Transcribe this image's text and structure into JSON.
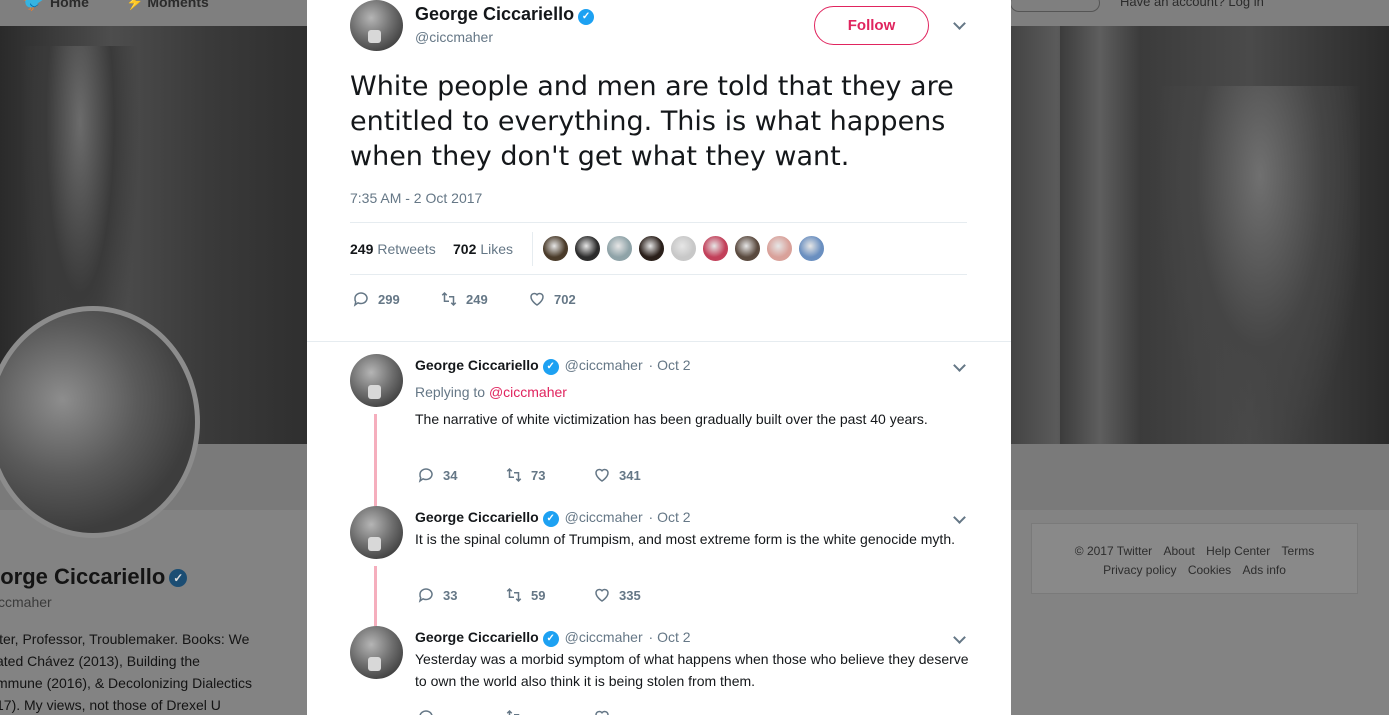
{
  "background_page": {
    "nav": {
      "home": "Home",
      "moments": "Moments",
      "account": "Have an account? Log in"
    },
    "profile": {
      "name": "eorge Ciccariello",
      "handle": "ccmaher",
      "bio_lines": [
        "iter, Professor, Troublemaker. Books: We",
        "ated Chávez (2013), Building the",
        "mmune (2016), & Decolonizing Dialectics",
        "17). My views, not those of Drexel U"
      ]
    },
    "footer": {
      "row1": [
        "© 2017 Twitter",
        "About",
        "Help Center",
        "Terms"
      ],
      "row2": [
        "Privacy policy",
        "Cookies",
        "Ads info"
      ]
    }
  },
  "main_tweet": {
    "name": "George Ciccariello",
    "handle": "@ciccmaher",
    "follow_label": "Follow",
    "text": "White people and men are told that they are entitled to everything. This is what happens when they don't get what they want.",
    "timestamp": "7:35 AM - 2 Oct 2017",
    "retweets_count": "249",
    "retweets_label": "Retweets",
    "likes_count": "702",
    "likes_label": "Likes",
    "liker_colors": [
      "#4a3b2a",
      "#2c2c2c",
      "#8fa3a8",
      "#2a1f1a",
      "#c8c8c8",
      "#c2405a",
      "#5a4a3f",
      "#d9a19a",
      "#6a8fc0"
    ],
    "actions": {
      "replies": "299",
      "retweets": "249",
      "likes": "702"
    }
  },
  "replies": [
    {
      "name": "George Ciccariello",
      "handle": "@ciccmaher",
      "date": "· Oct 2",
      "replying_prefix": "Replying to",
      "replying_to": "@ciccmaher",
      "text": "The narrative of white victimization has been gradually built over the past 40 years.",
      "replies": "34",
      "retweets": "73",
      "likes": "341"
    },
    {
      "name": "George Ciccariello",
      "handle": "@ciccmaher",
      "date": "· Oct 2",
      "text": "It is the spinal column of Trumpism, and most extreme form is the white genocide myth.",
      "replies": "33",
      "retweets": "59",
      "likes": "335"
    },
    {
      "name": "George Ciccariello",
      "handle": "@ciccmaher",
      "date": "· Oct 2",
      "text": "Yesterday was a morbid symptom of what happens when those who believe they deserve to own the world also think it is being stolen from them.",
      "replies": "",
      "retweets": "",
      "likes": ""
    }
  ],
  "colors": {
    "accent": "#e0245e",
    "verified": "#1da1f2",
    "thread": "#f5aebd",
    "muted": "#657786",
    "text": "#14171a"
  }
}
